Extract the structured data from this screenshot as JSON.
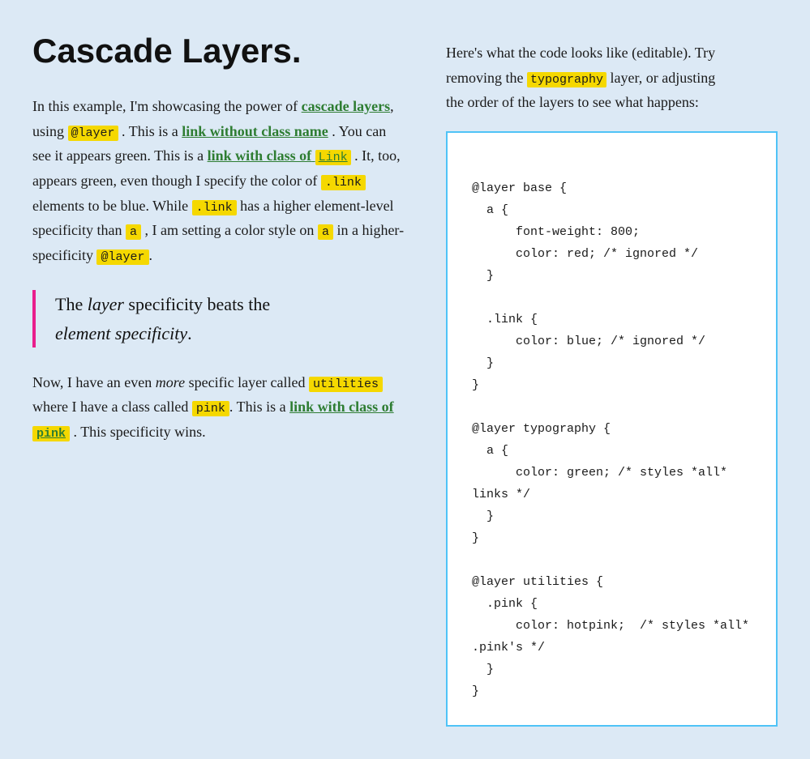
{
  "page": {
    "title": "Cascade Layers.",
    "bg_color": "#dce9f5"
  },
  "left": {
    "title": "Cascade Layers.",
    "intro": "In this example, I'm showcasing the power of",
    "cascade_layers_link": "cascade layers",
    "at_layer_badge": "@layer",
    "sentence1": ". This is a",
    "link_no_class": "link without class name",
    "sentence2": ". You can see it appears green. This is a",
    "link_with_class": "link with class of",
    "link_badge": "Link",
    "sentence3": ". It, too, appears green, even though I specify the color of",
    "link_badge2": ".link",
    "sentence4": "elements to be blue. While",
    "link_badge3": ".link",
    "sentence5": "has a higher element-level specificity than",
    "a_badge": "a",
    "sentence6": ", I am setting a color style on",
    "a_badge2": "a",
    "sentence7": "in a higher-specificity",
    "at_layer_badge2": "@layer",
    "sentence8": ".",
    "blockquote": "The layer specificity beats the element specificity.",
    "blockquote_italic1": "layer",
    "blockquote_italic2": "element specificity",
    "paragraph2_start": "Now, I have an even",
    "more_italic": "more",
    "paragraph2_mid": "specific layer called",
    "utilities_badge": "utilities",
    "paragraph2_mid2": "where I have a class called",
    "pink_badge": "pink",
    "paragraph2_end": ". This is a",
    "pink_link_text": "link with class of",
    "pink_highlight": "pink",
    "paragraph2_final": ". This specificity wins."
  },
  "right": {
    "intro_line1": "Here's what the code looks like (editable). Try",
    "intro_line2": "removing the",
    "typography_badge": "typography",
    "intro_line3": "layer, or adjusting",
    "intro_line4": "the order of the layers to see what happens:",
    "code": "@layer base {\n  a {\n      font-weight: 800;\n      color: red; /* ignored */\n  }\n\n  .link {\n      color: blue; /* ignored */\n  }\n}\n\n@layer typography {\n  a {\n      color: green; /* styles *all*\nlinks */\n  }\n}\n\n@layer utilities {\n  .pink {\n      color: hotpink;  /* styles *all*\n.pink's */\n  }\n}"
  }
}
